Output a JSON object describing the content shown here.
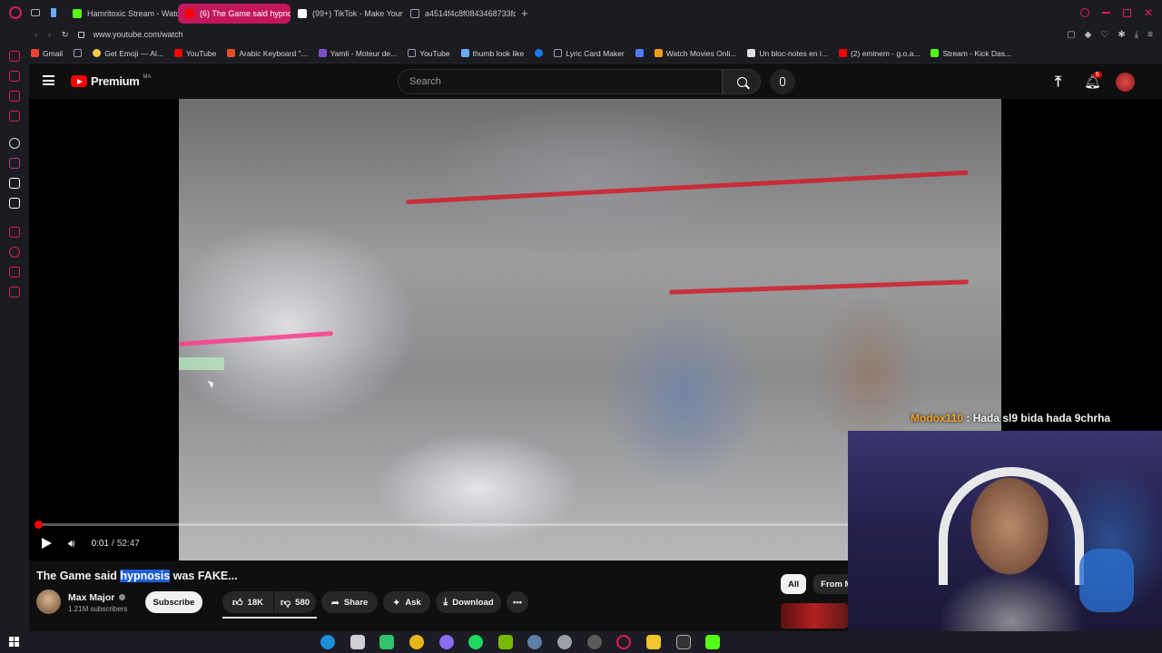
{
  "browser": {
    "tabs": [
      {
        "label": "Hamritoxic Stream - Watch",
        "active": false,
        "color": "#53fc18"
      },
      {
        "label": "(6) The Game said hypnosis",
        "active": true,
        "color": "#ff0000"
      },
      {
        "label": "(99+) TikTok - Make Your",
        "active": false,
        "color": "#ffffff"
      },
      {
        "label": "a4514f4c8f0843468733fc",
        "active": false,
        "color": "#9a9aa5"
      }
    ],
    "url": "www.youtube.com/watch",
    "bookmarks": [
      {
        "label": "Gmail",
        "color": "#ea4335"
      },
      {
        "label": "",
        "color": "#9a9aa5"
      },
      {
        "label": "Get Emoji — Al...",
        "color": "#f7c948"
      },
      {
        "label": "YouTube",
        "color": "#ff0000"
      },
      {
        "label": "Arabic Keyboard \"...",
        "color": "#e44d26"
      },
      {
        "label": "Yamli - Moteur de...",
        "color": "#7b4fc9"
      },
      {
        "label": "YouTube",
        "color": "#9a9aa5"
      },
      {
        "label": "thumb look like",
        "color": "#6aa9ff"
      },
      {
        "label": "",
        "color": "#1877f2"
      },
      {
        "label": "Lyric Card Maker",
        "color": "#9a9aa5"
      },
      {
        "label": "",
        "color": "#4f7cf7"
      },
      {
        "label": "Watch Movies Onli...",
        "color": "#f09a1a"
      },
      {
        "label": "Un bloc-notes en l...",
        "color": "#dddddd"
      },
      {
        "label": "(2) eminem - g.o.a...",
        "color": "#ff0000"
      },
      {
        "label": "Stream - Kick Das...",
        "color": "#53fc18"
      }
    ]
  },
  "youtube": {
    "logo_text": "Premium",
    "region": "MA",
    "search_placeholder": "Search",
    "notification_count": "6"
  },
  "player": {
    "time_current": "0:01",
    "time_sep": "/",
    "time_total": "52:47",
    "progress": 0.0003
  },
  "video": {
    "title_before": "The Game said ",
    "title_highlight": "hypnosis",
    "title_after": " was FAKE...",
    "channel": "Max Major",
    "subscribers": "1.21M subscribers",
    "subscribe_label": "Subscribe",
    "likes": "18K",
    "dislikes": "580",
    "share_label": "Share",
    "ask_label": "Ask",
    "download_label": "Download"
  },
  "chips": [
    "All",
    "From Ma"
  ],
  "stream_chat": {
    "user": "Modox110",
    "separator": " : ",
    "message": "Hada sl9 bida hada 9chrha",
    "user_color": "#f0a020"
  },
  "colors": {
    "accent": "#c2175b",
    "yt_red": "#ff0000"
  }
}
